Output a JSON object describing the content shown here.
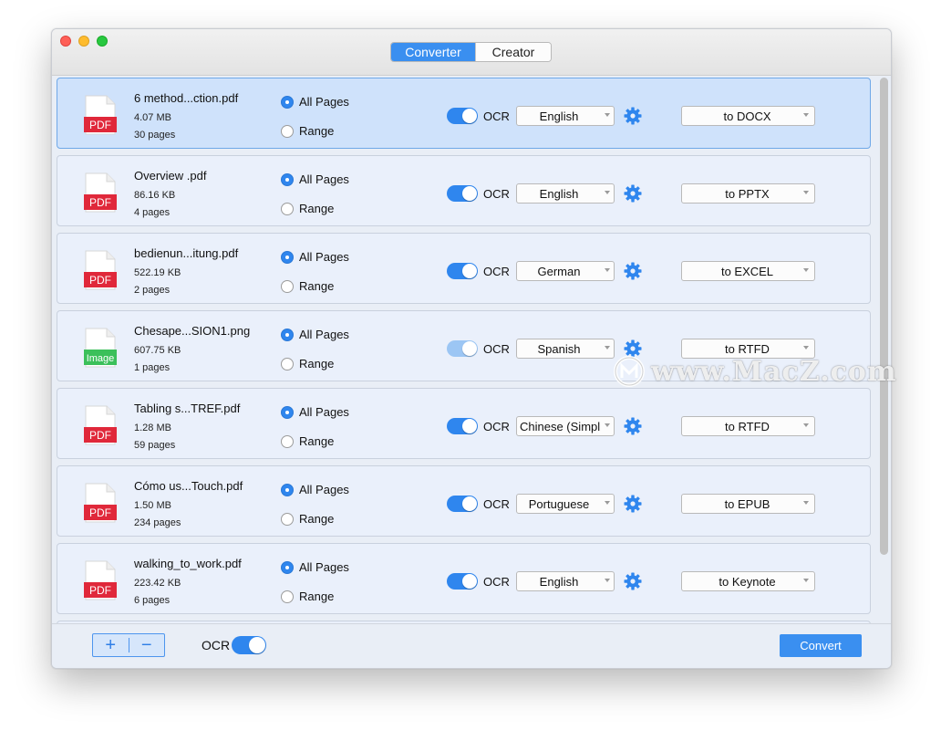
{
  "titlebar": {
    "tabs": [
      "Converter",
      "Creator"
    ],
    "active_tab": "Converter"
  },
  "colors": {
    "accent": "#3a8ff0",
    "pdf_badge": "#e0283a",
    "image_badge": "#3bc05a",
    "selected_row": "#cfe2fb"
  },
  "files": [
    {
      "name": "6 method...ction.pdf",
      "size": "4.07 MB",
      "pages": "30 pages",
      "type_badge": "PDF",
      "page_mode_all": "All Pages",
      "page_mode_range": "Range",
      "ocr_label": "OCR",
      "ocr_on": true,
      "language": "English",
      "format": "to DOCX",
      "selected": true
    },
    {
      "name": "Overview .pdf",
      "size": "86.16 KB",
      "pages": "4 pages",
      "type_badge": "PDF",
      "page_mode_all": "All Pages",
      "page_mode_range": "Range",
      "ocr_label": "OCR",
      "ocr_on": true,
      "language": "English",
      "format": "to PPTX",
      "selected": false
    },
    {
      "name": "bedienun...itung.pdf",
      "size": "522.19 KB",
      "pages": "2 pages",
      "type_badge": "PDF",
      "page_mode_all": "All Pages",
      "page_mode_range": "Range",
      "ocr_label": "OCR",
      "ocr_on": true,
      "language": "German",
      "format": "to EXCEL",
      "selected": false
    },
    {
      "name": "Chesape...SION1.png",
      "size": "607.75 KB",
      "pages": "1 pages",
      "type_badge": "Image",
      "page_mode_all": "All Pages",
      "page_mode_range": "Range",
      "ocr_label": "OCR",
      "ocr_on": true,
      "language": "Spanish",
      "format": "to RTFD",
      "selected": false
    },
    {
      "name": "Tabling s...TREF.pdf",
      "size": "1.28 MB",
      "pages": "59 pages",
      "type_badge": "PDF",
      "page_mode_all": "All Pages",
      "page_mode_range": "Range",
      "ocr_label": "OCR",
      "ocr_on": true,
      "language": "Chinese (Simpli...",
      "format": "to RTFD",
      "selected": false
    },
    {
      "name": "Cómo us...Touch.pdf",
      "size": "1.50 MB",
      "pages": "234 pages",
      "type_badge": "PDF",
      "page_mode_all": "All Pages",
      "page_mode_range": "Range",
      "ocr_label": "OCR",
      "ocr_on": true,
      "language": "Portuguese",
      "format": "to EPUB",
      "selected": false
    },
    {
      "name": "walking_to_work.pdf",
      "size": "223.42 KB",
      "pages": "6 pages",
      "type_badge": "PDF",
      "page_mode_all": "All Pages",
      "page_mode_range": "Range",
      "ocr_label": "OCR",
      "ocr_on": true,
      "language": "English",
      "format": "to Keynote",
      "selected": false
    }
  ],
  "bottom": {
    "add_label": "+",
    "remove_label": "−",
    "ocr_label": "OCR",
    "ocr_on": true,
    "convert_label": "Convert"
  },
  "watermark": {
    "text": "www.MacZ.com"
  }
}
